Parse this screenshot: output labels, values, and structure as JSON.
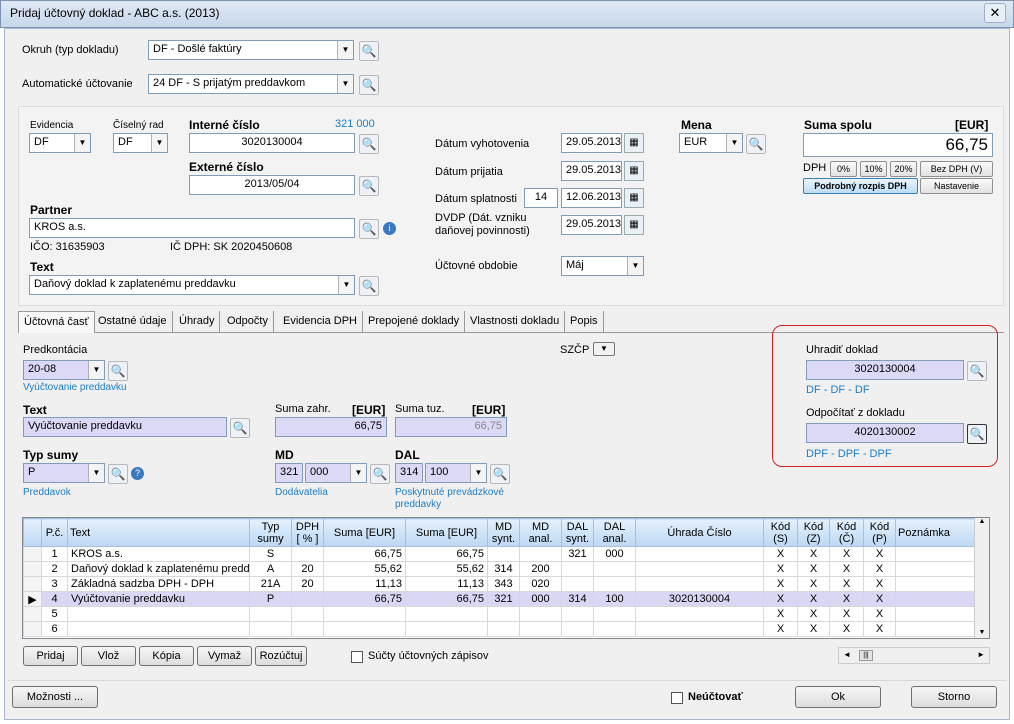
{
  "window": {
    "title": "Pridaj účtovný doklad - ABC a.s. (2013)",
    "close": "✕"
  },
  "header": {
    "okruh_label": "Okruh (typ dokladu)",
    "okruh_value": "DF - Došlé faktúry",
    "auto_label": "Automatické účtovanie",
    "auto_value": "24 DF - S prijatým preddavkom"
  },
  "doc": {
    "evidencia_label": "Evidencia",
    "evidencia_value": "DF",
    "ciselny_label": "Číselný rad",
    "ciselny_value": "DF",
    "interne_label": "Interné číslo",
    "interne_nums": "321  000",
    "interne_value": "3020130004",
    "externe_label": "Externé číslo",
    "externe_value": "2013/05/04",
    "partner_label": "Partner",
    "partner_value": "KROS a.s.",
    "ico": "IČO:  31635903",
    "icdph": "IČ DPH:  SK 2020450608",
    "text_label": "Text",
    "text_value": "Daňový doklad k zaplatenému preddavku",
    "dat_vyhot_label": "Dátum vyhotovenia",
    "dat_vyhot": "29.05.2013",
    "dat_prij_label": "Dátum prijatia",
    "dat_prij": "29.05.2013",
    "dat_splat_label": "Dátum splatnosti",
    "dat_splat_days": "14",
    "dat_splat": "12.06.2013",
    "dvdp_label": "DVDP (Dát. vzniku daňovej povinnosti)",
    "dvdp": "29.05.2013",
    "obdobie_label": "Účtovné obdobie",
    "obdobie": "Máj",
    "mena_label": "Mena",
    "mena": "EUR",
    "suma_label": "Suma spolu",
    "suma_cur": "[EUR]",
    "suma": "66,75",
    "dph_label": "DPH",
    "dph0": "0%",
    "dph10": "10%",
    "dph20": "20%",
    "bez_dph": "Bez DPH (V)",
    "rozpis_btn": "Podrobný rozpis DPH",
    "nastavenie_btn": "Nastavenie"
  },
  "tabs": [
    "Účtovná časť",
    "Ostatné údaje",
    "Úhrady",
    "Odpočty",
    "Evidencia DPH",
    "Prepojené doklady",
    "Vlastnosti dokladu",
    "Popis"
  ],
  "account": {
    "predkont_label": "Predkontácia",
    "predkont": "20-08",
    "predkont_hint": "Vyúčtovanie preddavku",
    "szcp_label": "SZČP",
    "text_label": "Text",
    "text_value": "Vyúčtovanie preddavku",
    "suma_zahr_label": "Suma zahr.",
    "suma_zahr_cur": "[EUR]",
    "suma_zahr": "66,75",
    "suma_tuz_label": "Suma tuz.",
    "suma_tuz_cur": "[EUR]",
    "suma_tuz": "66,75",
    "typ_label": "Typ sumy",
    "typ_value": "P",
    "typ_hint": "Preddavok",
    "md_label": "MD",
    "md_synt": "321",
    "md_anal": "000",
    "md_hint": "Dodávatelia",
    "dal_label": "DAL",
    "dal_synt": "314",
    "dal_anal": "100",
    "dal_hint": "Poskytnuté prevádzkové preddavky",
    "uhradit_label": "Uhradiť doklad",
    "uhradit_value": "3020130004",
    "uhradit_hint": "DF - DF - DF",
    "odpocitat_label": "Odpočítať z dokladu",
    "odpocitat_value": "4020130002",
    "odpocitat_hint": "DPF - DPF - DPF"
  },
  "grid": {
    "headers": [
      "P.č.",
      "Text",
      "Typ sumy",
      "DPH [ % ]",
      "Suma [EUR]",
      "Suma [EUR]",
      "MD synt.",
      "MD anal.",
      "DAL synt.",
      "DAL anal.",
      "Úhrada Číslo",
      "Kód (S)",
      "Kód (Z)",
      "Kód (Č)",
      "Kód (P)",
      "Poznámka"
    ],
    "rows": [
      {
        "n": "1",
        "text": "KROS a.s.",
        "typ": "S",
        "dph": "",
        "s1": "66,75",
        "s2": "66,75",
        "mds": "",
        "mda": "",
        "dals": "321",
        "dala": "000",
        "uh": "",
        "ks": "X",
        "kz": "X",
        "kc": "X",
        "kp": "X"
      },
      {
        "n": "2",
        "text": "Daňový doklad k zaplatenému predda",
        "typ": "A",
        "dph": "20",
        "s1": "55,62",
        "s2": "55,62",
        "mds": "314",
        "mda": "200",
        "dals": "",
        "dala": "",
        "uh": "",
        "ks": "X",
        "kz": "X",
        "kc": "X",
        "kp": "X"
      },
      {
        "n": "3",
        "text": "Základná sadzba DPH - DPH",
        "typ": "21A",
        "dph": "20",
        "s1": "11,13",
        "s2": "11,13",
        "mds": "343",
        "mda": "020",
        "dals": "",
        "dala": "",
        "uh": "",
        "ks": "X",
        "kz": "X",
        "kc": "X",
        "kp": "X"
      },
      {
        "n": "4",
        "text": "Vyúčtovanie preddavku",
        "typ": "P",
        "dph": "",
        "s1": "66,75",
        "s2": "66,75",
        "mds": "321",
        "mda": "000",
        "dals": "314",
        "dala": "100",
        "uh": "3020130004",
        "ks": "X",
        "kz": "X",
        "kc": "X",
        "kp": "X"
      },
      {
        "n": "5",
        "text": "",
        "typ": "",
        "dph": "",
        "s1": "",
        "s2": "",
        "mds": "",
        "mda": "",
        "dals": "",
        "dala": "",
        "uh": "",
        "ks": "X",
        "kz": "X",
        "kc": "X",
        "kp": "X"
      },
      {
        "n": "6",
        "text": "",
        "typ": "",
        "dph": "",
        "s1": "",
        "s2": "",
        "mds": "",
        "mda": "",
        "dals": "",
        "dala": "",
        "uh": "",
        "ks": "X",
        "kz": "X",
        "kc": "X",
        "kp": "X"
      }
    ],
    "selected_row": 3
  },
  "gridbar": {
    "pridaj": "Pridaj",
    "vloz": "Vlož",
    "kopia": "Kópia",
    "vymaz": "Vymaž",
    "rozuctuj": "Rozúčtuj",
    "sucty": "Súčty účtovných zápisov"
  },
  "footer": {
    "moznosti": "Možnosti ...",
    "neuctovat": "Neúčtovať",
    "ok": "Ok",
    "storno": "Storno"
  }
}
